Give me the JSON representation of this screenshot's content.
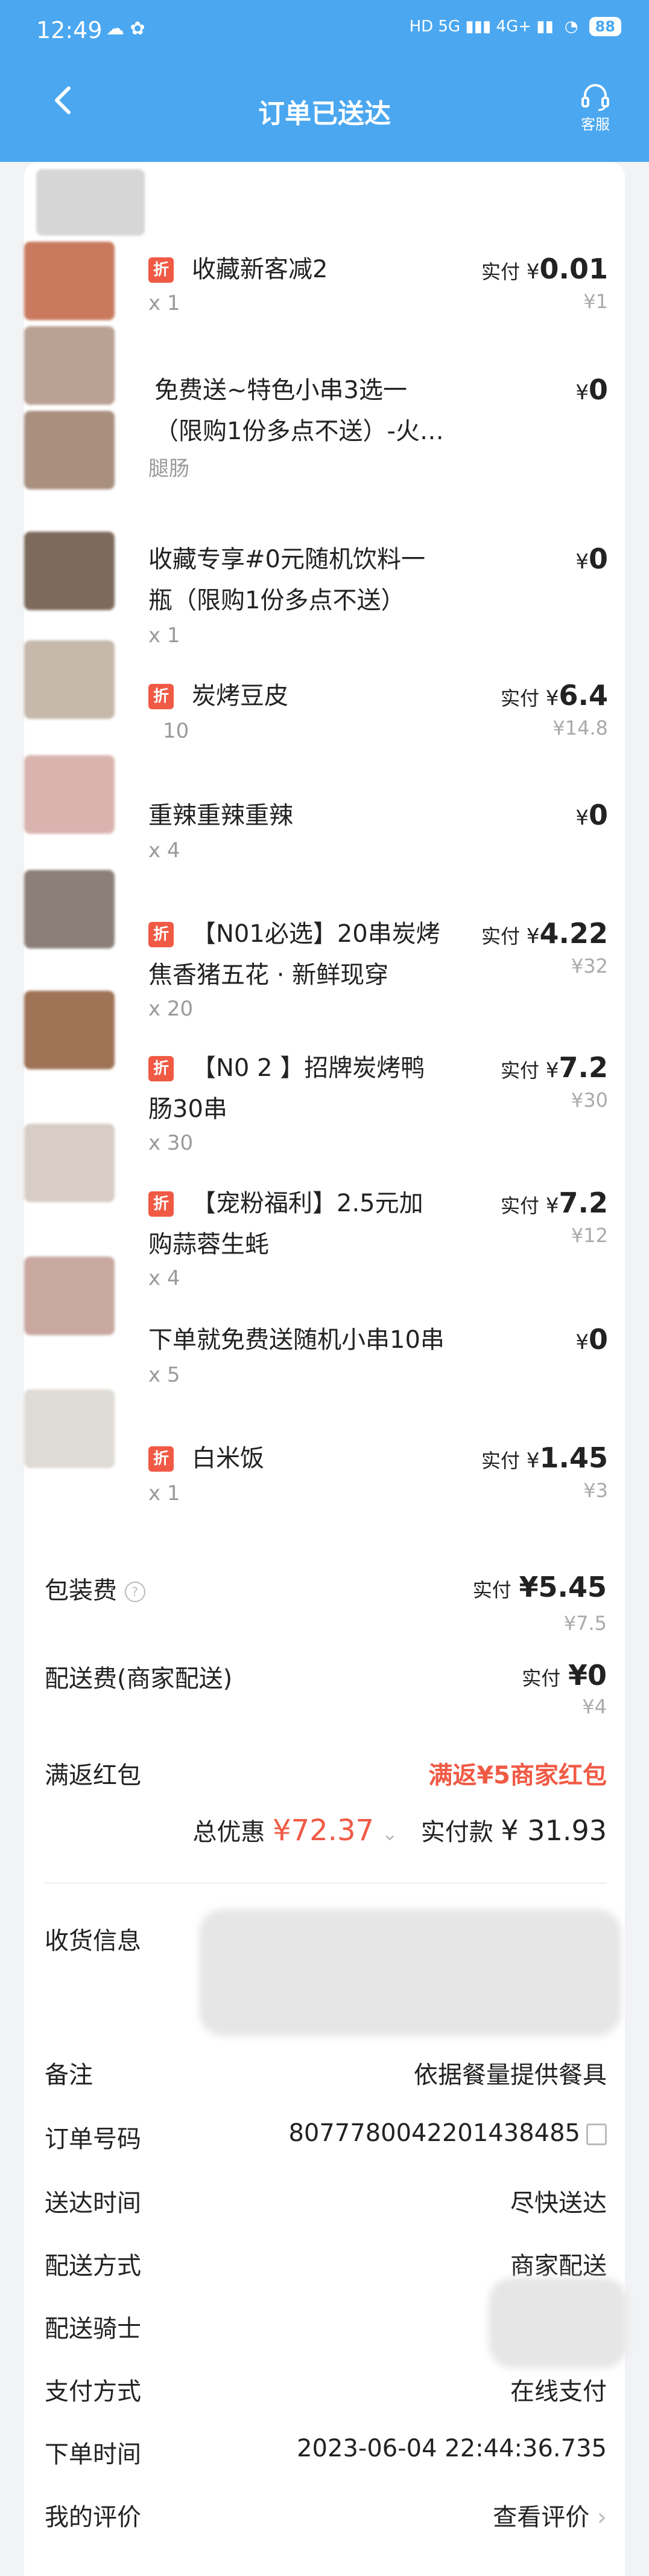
{
  "status_bar": {
    "time": "12:49",
    "notif_icons": "☁ ✿",
    "signal": "HD 5G ▮▮▮ 4G+ ▮▮",
    "battery": "88"
  },
  "header": {
    "title": "订单已送达",
    "service_label": "客服"
  },
  "items": [
    {
      "name_lines": [
        "收藏新客减2"
      ],
      "tag": "折",
      "qty": "x 1",
      "price_label": "实付",
      "currency": "¥",
      "price": "0.01",
      "orig": "¥1"
    },
    {
      "name_lines": [
        "免费送~特色小串3选一",
        "（限购1份多点不送）-火…"
      ],
      "tag": "",
      "qty": "腿肠",
      "price_label": "",
      "currency": "¥",
      "price": "0",
      "orig": ""
    },
    {
      "name_lines": [
        "收藏专享#0元随机饮料一",
        "瓶（限购1份多点不送）"
      ],
      "tag": "",
      "qty": "x 1",
      "price_label": "",
      "currency": "¥",
      "price": "0",
      "orig": ""
    },
    {
      "name_lines": [
        "炭烤豆皮"
      ],
      "tag": "折",
      "qty": "10",
      "price_label": "实付",
      "currency": "¥",
      "price": "6.4",
      "orig": "¥14.8"
    },
    {
      "name_lines": [
        "重辣重辣重辣"
      ],
      "tag": "",
      "qty": "x 4",
      "price_label": "",
      "currency": "¥",
      "price": "0",
      "orig": ""
    },
    {
      "name_lines": [
        "【N01必选】20串炭烤",
        "焦香猪五花 · 新鲜现穿"
      ],
      "tag": "折",
      "qty": "x 20",
      "price_label": "实付",
      "currency": "¥",
      "price": "4.22",
      "orig": "¥32"
    },
    {
      "name_lines": [
        "【N0 2 】招牌炭烤鸭",
        "肠30串"
      ],
      "tag": "折",
      "qty": "x 30",
      "price_label": "实付",
      "currency": "¥",
      "price": "7.2",
      "orig": "¥30"
    },
    {
      "name_lines": [
        "【宠粉福利】2.5元加",
        "购蒜蓉生蚝"
      ],
      "tag": "折",
      "qty": "x 4",
      "price_label": "实付",
      "currency": "¥",
      "price": "7.2",
      "orig": "¥12"
    },
    {
      "name_lines": [
        "下单就免费送随机小串10串"
      ],
      "tag": "",
      "qty": "x 5",
      "price_label": "",
      "currency": "¥",
      "price": "0",
      "orig": ""
    },
    {
      "name_lines": [
        "白米饭"
      ],
      "tag": "折",
      "qty": "x 1",
      "price_label": "实付",
      "currency": "¥",
      "price": "1.45",
      "orig": "¥3"
    }
  ],
  "fees": {
    "packaging": {
      "label": "包装费",
      "pay_label": "实付",
      "value": "¥5.45",
      "orig": "¥7.5"
    },
    "delivery": {
      "label": "配送费(商家配送)",
      "pay_label": "实付",
      "value": "¥0",
      "orig": "¥4"
    },
    "cashback": {
      "label": "满返红包",
      "value": "满返¥5商家红包"
    }
  },
  "totals": {
    "discount_label": "总优惠",
    "discount": "¥72.37",
    "paid_label": "实付款",
    "paid": "¥ 31.93"
  },
  "info": {
    "receiver": {
      "label": "收货信息"
    },
    "note": {
      "label": "备注",
      "value": "依据餐量提供餐具"
    },
    "order_no": {
      "label": "订单号码",
      "value": "8077780042201438485"
    },
    "delivery_time": {
      "label": "送达时间",
      "value": "尽快送达"
    },
    "delivery_method": {
      "label": "配送方式",
      "value": "商家配送"
    },
    "rider": {
      "label": "配送骑士"
    },
    "pay_method": {
      "label": "支付方式",
      "value": "在线支付"
    },
    "order_time": {
      "label": "下单时间",
      "value": "2023-06-04 22:44:36.735"
    },
    "review": {
      "label": "我的评价",
      "value": "查看评价"
    }
  },
  "colors": {
    "header": "#4aa7f0",
    "accent_red": "#f05a45",
    "muted": "#9a9a9a"
  }
}
